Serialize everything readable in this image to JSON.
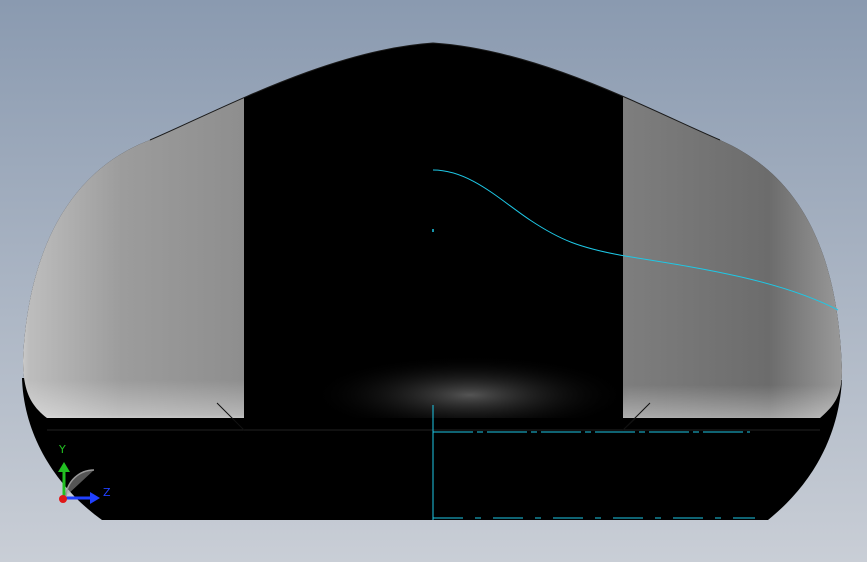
{
  "viewport": {
    "background_top_color": "#8a9ab0",
    "background_bottom_color": "#c9ced6",
    "model_color": "#000000",
    "surface_light_color": "#e8e8e8",
    "surface_dark_color": "#6a6a6a",
    "sketch_color": "#1ec8e6"
  },
  "triad": {
    "y_label": "Y",
    "z_label": "Z",
    "y_color": "#22c022",
    "z_color": "#2040ff",
    "x_color": "#e01818",
    "y_icon": "y-axis-arrow",
    "z_icon": "z-axis-arrow",
    "x_icon": "x-axis-dot"
  }
}
